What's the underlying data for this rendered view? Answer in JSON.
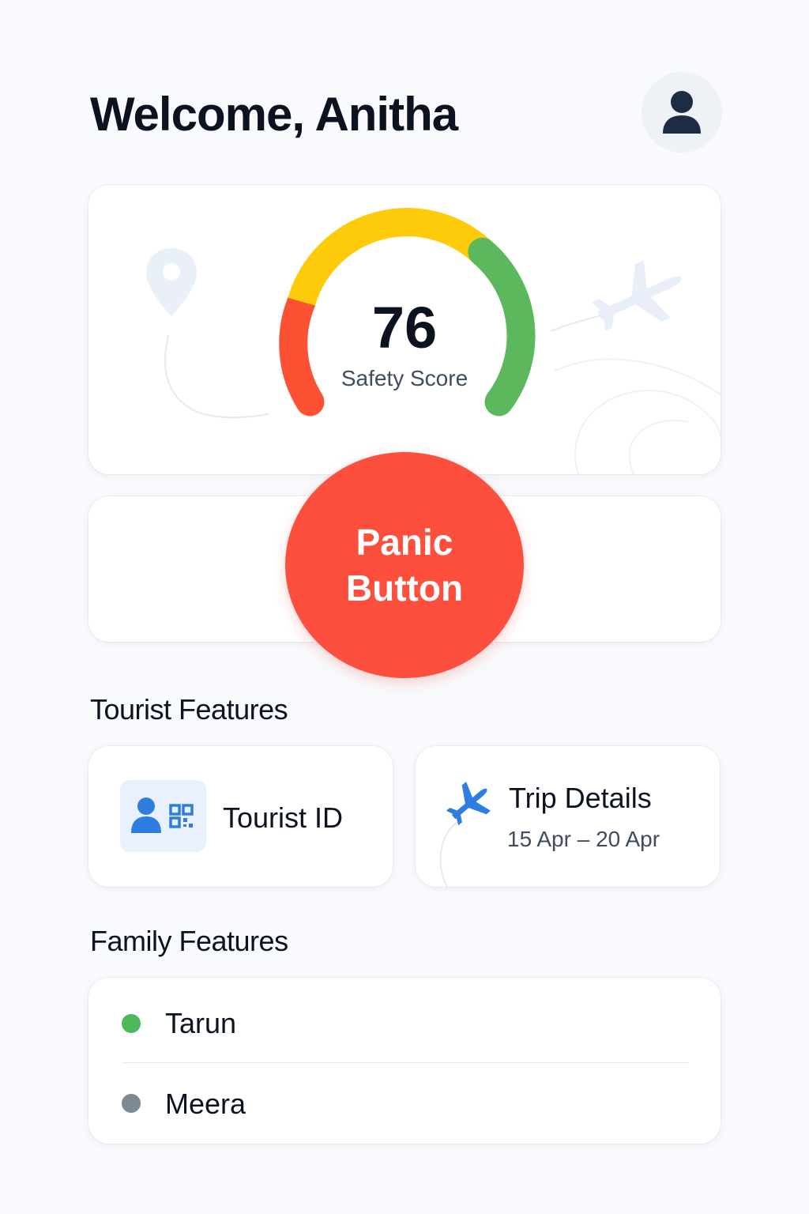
{
  "header": {
    "title": "Welcome, Anitha",
    "avatar_icon": "user-avatar-icon"
  },
  "safety": {
    "score": "76",
    "label": "Safety Score",
    "gauge_colors": [
      "#fd5134",
      "#fecb0a",
      "#5cb85c"
    ]
  },
  "panic": {
    "line1": "Panic",
    "line2": "Button",
    "color": "#fd4f3d"
  },
  "tourist_features": {
    "title": "Tourist Features",
    "tourist_id": {
      "label": "Tourist ID",
      "icon": "tourist-id-icon"
    },
    "trip": {
      "label": "Trip Details",
      "dates": "15 Apr – 20 Apr",
      "icon": "airplane-icon"
    }
  },
  "family_features": {
    "title": "Family Features",
    "members": [
      {
        "name": "Tarun",
        "status_color": "#4cb85a"
      },
      {
        "name": "Meera",
        "status_color": "#7d8a96"
      }
    ]
  }
}
